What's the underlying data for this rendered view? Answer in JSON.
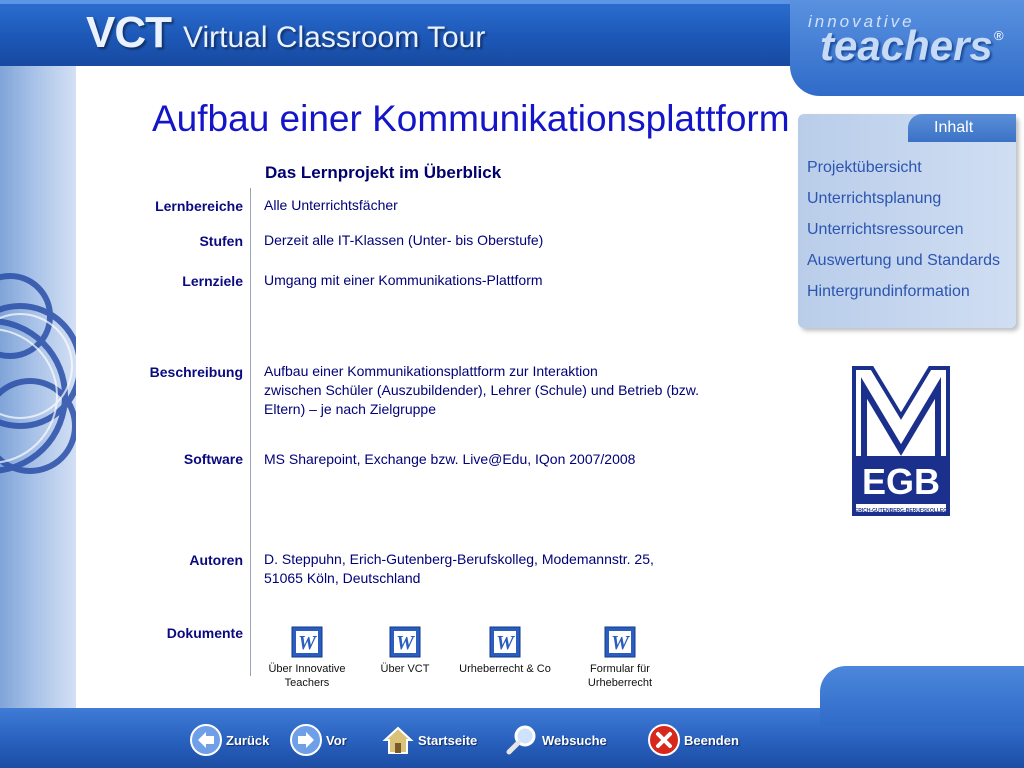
{
  "header": {
    "brand_short": "VCT",
    "brand_long": "Virtual Classroom Tour"
  },
  "logo": {
    "small": "innovative",
    "big": "teachers",
    "reg": "®"
  },
  "title": "Aufbau einer Kommunikationsplattform",
  "subtitle": "Das Lernprojekt im Überblick",
  "rows": [
    {
      "label": "Lernbereiche",
      "value": "Alle Unterrichtsfächer"
    },
    {
      "label": "Stufen",
      "value": "Derzeit alle IT-Klassen (Unter- bis Oberstufe)"
    },
    {
      "label": "Lernziele",
      "value": "Umgang mit einer Kommunikations-Plattform"
    },
    {
      "label": "Beschreibung",
      "value_lines": [
        "Aufbau einer Kommunikationsplattform zur Interaktion",
        "zwischen Schüler (Auszubildender), Lehrer (Schule) und Betrieb (bzw.",
        "Eltern) – je nach Zielgruppe"
      ]
    },
    {
      "label": "Software",
      "value": "MS Sharepoint, Exchange bzw. Live@Edu, IQon 2007/2008"
    },
    {
      "label": "Autoren",
      "value_lines": [
        "D. Steppuhn, Erich-Gutenberg-Berufskolleg, Modemannstr. 25,",
        "51065 Köln, Deutschland"
      ]
    },
    {
      "label": "Dokumente"
    }
  ],
  "documents": [
    {
      "lines": [
        "Über Innovative",
        "Teachers"
      ],
      "icon": "word-doc-icon"
    },
    {
      "lines": [
        "Über VCT"
      ],
      "icon": "word-doc-icon"
    },
    {
      "lines": [
        "Urheberrecht & Co"
      ],
      "icon": "word-doc-icon"
    },
    {
      "lines": [
        "Formular für",
        "Urheberrecht"
      ],
      "icon": "word-doc-icon"
    }
  ],
  "menu": {
    "tab": "Inhalt",
    "items": [
      "Projektübersicht",
      "Unterrichtsplanung",
      "Unterrichtsressourcen",
      "Auswertung und Standards",
      "Hintergrundinformation"
    ]
  },
  "egb_logo": {
    "letters": "EGB",
    "ring_text": "ERICH-GUTENBERG-BERUFSKOLLEG"
  },
  "nav": [
    {
      "label": "Zurück",
      "icon": "arrow-left-icon"
    },
    {
      "label": "Vor",
      "icon": "arrow-right-icon"
    },
    {
      "label": "Startseite",
      "icon": "home-icon"
    },
    {
      "label": "Websuche",
      "icon": "magnifier-icon"
    },
    {
      "label": "Beenden",
      "icon": "close-icon"
    }
  ],
  "colors": {
    "title": "#1414c8",
    "label": "#0a0a80",
    "bar": "#2a63c0",
    "menu_text": "#2c55b0"
  }
}
